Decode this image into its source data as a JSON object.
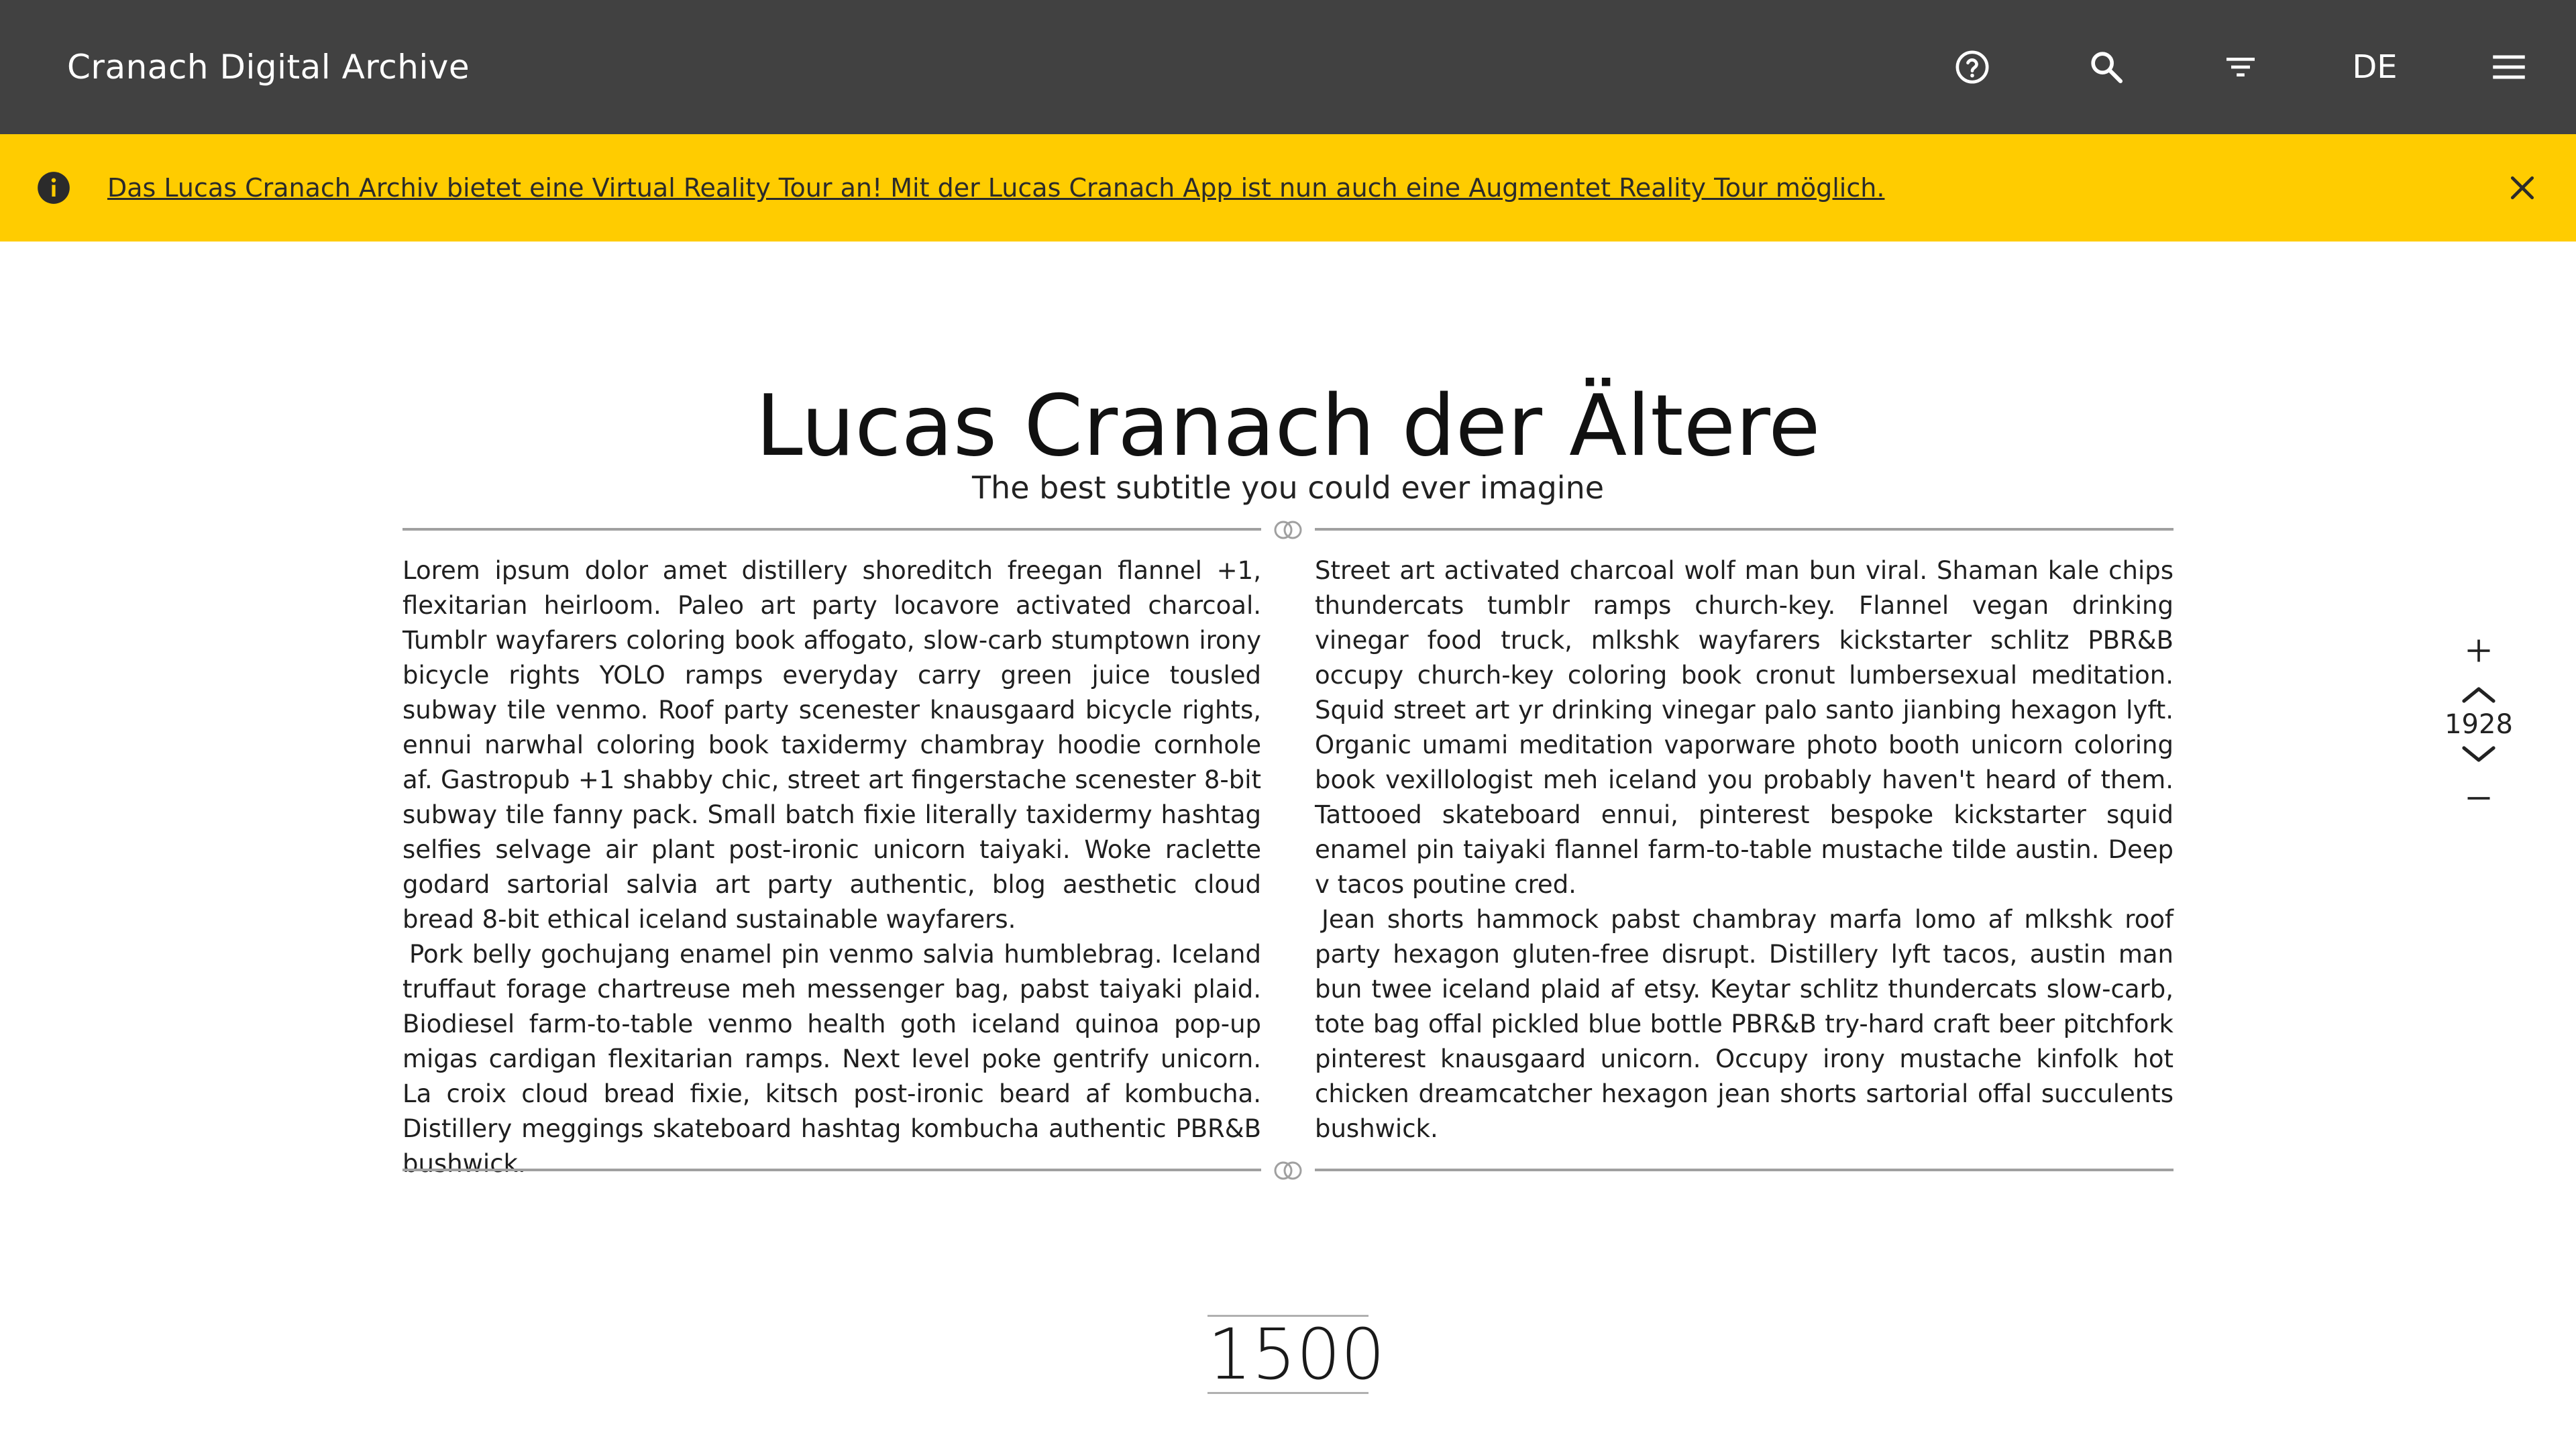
{
  "header": {
    "title": "Cranach Digital Archive",
    "help_icon": "help-circle-icon",
    "search_icon": "search-icon",
    "filter_icon": "filter-icon",
    "language": "DE",
    "menu_icon": "hamburger-menu-icon",
    "background": "#414141"
  },
  "banner": {
    "text": "Das Lucas Cranach Archiv bietet eine Virtual Reality Tour an! Mit der Lucas Cranach App ist nun auch eine Augmentet Reality Tour möglich.",
    "info_icon": "info-icon",
    "close_icon": "close-icon",
    "background": "#ffcc00"
  },
  "main": {
    "title": "Lucas Cranach der Ältere",
    "subtitle": "The best subtitle you could ever imagine",
    "divider_icon": "rings-ornament-icon",
    "left_column": [
      "Lorem ipsum dolor amet distillery shoreditch freegan flannel +1, flexitarian heirloom. Paleo art party locavore activated charcoal. Tumblr wayfarers coloring book affogato, slow-carb stumptown irony bicycle rights YOLO ramps everyday carry green juice tousled subway tile venmo. Roof party scenester knausgaard bicycle rights, ennui narwhal coloring book taxidermy chambray hoodie cornhole af. Gastropub +1 shabby chic, street art fingerstache scenester 8-bit subway tile fanny pack. Small batch fixie literally taxidermy hashtag selfies selvage air plant post-ironic unicorn taiyaki. Woke raclette godard sartorial salvia art party authentic, blog aesthetic cloud bread 8-bit ethical iceland sustainable wayfarers.",
      "Pork belly gochujang enamel pin venmo salvia humblebrag. Iceland truffaut forage chartreuse meh messenger bag, pabst taiyaki plaid. Biodiesel farm-to-table venmo health goth iceland quinoa pop-up migas cardigan flexitarian ramps. Next level poke gentrify unicorn. La croix cloud bread fixie, kitsch post-ironic beard af kombucha. Distillery meggings skateboard hashtag kombucha authentic PBR&B bushwick."
    ],
    "right_column": [
      "Street art activated charcoal wolf man bun viral. Shaman kale chips thundercats tumblr ramps church-key. Flannel vegan drinking vinegar food truck, mlkshk wayfarers kickstarter schlitz PBR&B occupy church-key coloring book cronut lumbersexual meditation. Squid street art yr drinking vinegar palo santo jianbing hexagon lyft. Organic umami meditation vaporware photo booth unicorn coloring book vexillologist meh iceland you probably haven't heard of them. Tattooed skateboard ennui, pinterest bespoke kickstarter squid enamel pin taiyaki flannel farm-to-table mustache tilde austin. Deep v tacos poutine cred.",
      "Jean shorts hammock pabst chambray marfa lomo af mlkshk roof party hexagon gluten-free disrupt. Distillery lyft tacos, austin man bun twee iceland plaid af etsy. Keytar schlitz thundercats slow-carb, tote bag offal pickled blue bottle PBR&B try-hard craft beer pitchfork pinterest knausgaard unicorn. Occupy irony mustache kinfolk hot chicken dreamcatcher hexagon jean shorts sartorial offal succulents bushwick."
    ],
    "year": "1500"
  },
  "timeline_controls": {
    "zoom_in_icon": "plus-icon",
    "prev_icon": "chevron-up-icon",
    "current_year": "1928",
    "next_icon": "chevron-down-icon",
    "zoom_out_icon": "minus-icon"
  }
}
